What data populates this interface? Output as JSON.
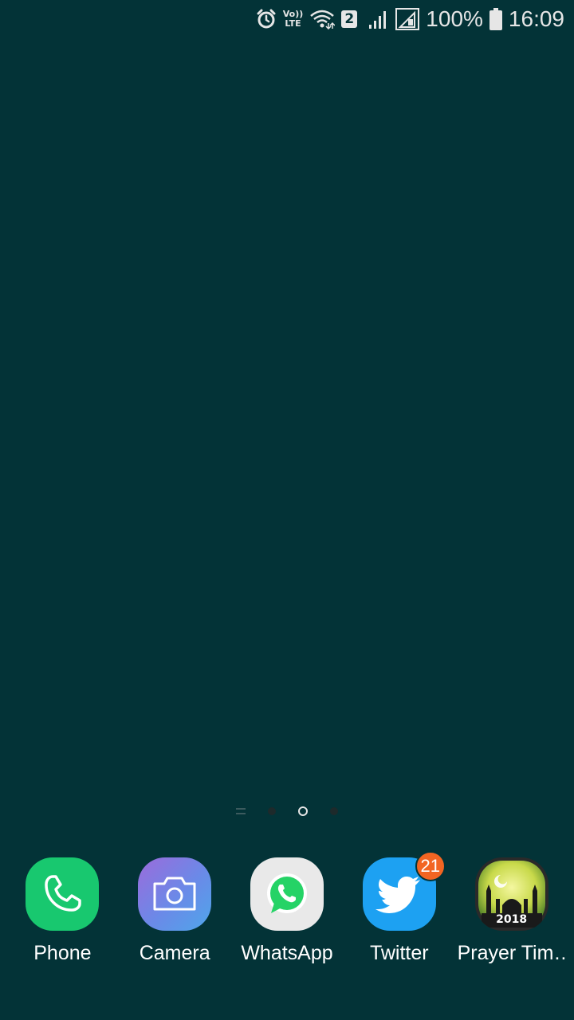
{
  "status_bar": {
    "volte_top": "Vo))",
    "volte_bottom": "LTE",
    "sim_number": "2",
    "battery_percent": "100%",
    "time": "16:09",
    "icons": [
      "alarm-icon",
      "volte-icon",
      "wifi-icon",
      "sim2-icon",
      "signal-icon",
      "signal-icon-2",
      "battery-icon"
    ]
  },
  "page_indicator": {
    "total_pages": 3,
    "current_page": 2
  },
  "dock": {
    "apps": [
      {
        "label": "Phone",
        "icon": "phone-icon",
        "color": "#18c86f"
      },
      {
        "label": "Camera",
        "icon": "camera-icon",
        "color": "#7b7fe0"
      },
      {
        "label": "WhatsApp",
        "icon": "whatsapp-icon",
        "color": "#25d366"
      },
      {
        "label": "Twitter",
        "icon": "twitter-bird-icon",
        "color": "#1da1f2",
        "badge": "21"
      },
      {
        "label": "Prayer Tim…",
        "icon": "mosque-icon",
        "color": "#c8d94a",
        "image_text": "2018"
      }
    ]
  },
  "colors": {
    "wallpaper": "#033337",
    "badge": "#f26522",
    "text": "#ffffff"
  }
}
